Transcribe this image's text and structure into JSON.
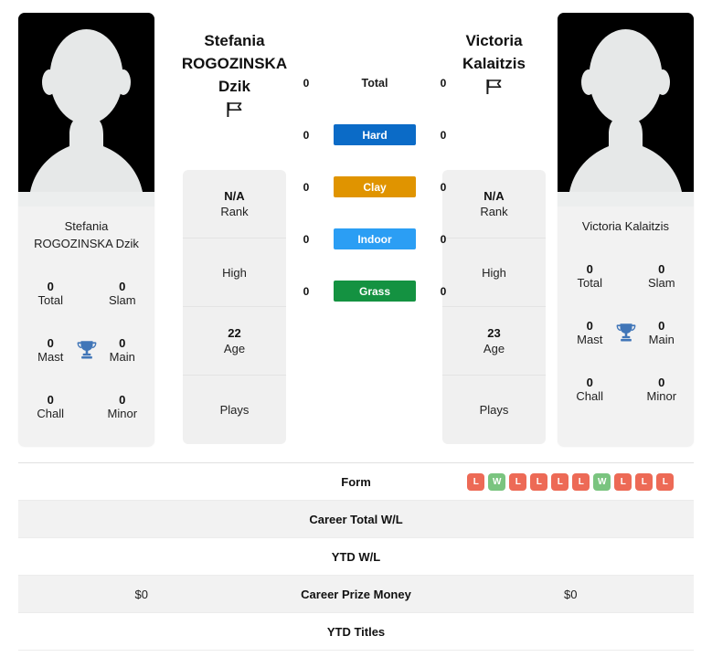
{
  "players": {
    "left": {
      "first_name": "Stefania",
      "last_name": "ROGOZINSKA Dzik",
      "display_name_line1": "Stefania",
      "display_name_line2": "ROGOZINSKA",
      "display_name_line3": "Dzik",
      "photo_caption": "Stefania ROGOZINSKA Dzik",
      "flag_icon": "flag-icon",
      "rank": "N/A",
      "rank_label": "Rank",
      "high_label": "High",
      "high_value": "",
      "age": "22",
      "age_label": "Age",
      "plays_label": "Plays",
      "plays_value": "",
      "titles": {
        "total": "0",
        "total_label": "Total",
        "slam": "0",
        "slam_label": "Slam",
        "mast": "0",
        "mast_label": "Mast",
        "main": "0",
        "main_label": "Main",
        "chall": "0",
        "chall_label": "Chall",
        "minor": "0",
        "minor_label": "Minor"
      },
      "career_total_wl": "",
      "ytd_wl": "",
      "career_prize_money": "$0",
      "ytd_titles": "",
      "form": []
    },
    "right": {
      "first_name": "Victoria",
      "last_name": "Kalaitzis",
      "display_name_line1": "Victoria",
      "display_name_line2": "Kalaitzis",
      "display_name_line3": "",
      "photo_caption": "Victoria Kalaitzis",
      "flag_icon": "flag-icon",
      "rank": "N/A",
      "rank_label": "Rank",
      "high_label": "High",
      "high_value": "",
      "age": "23",
      "age_label": "Age",
      "plays_label": "Plays",
      "plays_value": "",
      "titles": {
        "total": "0",
        "total_label": "Total",
        "slam": "0",
        "slam_label": "Slam",
        "mast": "0",
        "mast_label": "Mast",
        "main": "0",
        "main_label": "Main",
        "chall": "0",
        "chall_label": "Chall",
        "minor": "0",
        "minor_label": "Minor"
      },
      "career_total_wl": "",
      "ytd_wl": "",
      "career_prize_money": "$0",
      "ytd_titles": "",
      "form": [
        "L",
        "W",
        "L",
        "L",
        "L",
        "L",
        "W",
        "L",
        "L",
        "L"
      ]
    }
  },
  "surfaces": [
    {
      "label": "Total",
      "left": "0",
      "right": "0",
      "color": "transparent",
      "text_color": "#1c1c1c"
    },
    {
      "label": "Hard",
      "left": "0",
      "right": "0",
      "color": "#0b6bc7",
      "text_color": "#ffffff"
    },
    {
      "label": "Clay",
      "left": "0",
      "right": "0",
      "color": "#e09400",
      "text_color": "#ffffff"
    },
    {
      "label": "Indoor",
      "left": "0",
      "right": "0",
      "color": "#2b9ef4",
      "text_color": "#ffffff"
    },
    {
      "label": "Grass",
      "left": "0",
      "right": "0",
      "color": "#149241",
      "text_color": "#ffffff"
    }
  ],
  "table_rows": [
    {
      "label": "Form",
      "left": "",
      "right": ""
    },
    {
      "label": "Career Total W/L",
      "left": "",
      "right": ""
    },
    {
      "label": "YTD W/L",
      "left": "",
      "right": ""
    },
    {
      "label": "Career Prize Money",
      "left": "$0",
      "right": "$0"
    },
    {
      "label": "YTD Titles",
      "left": "",
      "right": ""
    }
  ],
  "colors": {
    "hard": "#0b6bc7",
    "clay": "#e09400",
    "indoor": "#2b9ef4",
    "grass": "#149241",
    "loss_badge": "#ed6a56",
    "win_badge": "#7ac47f",
    "card_bg": "#f0f0f0",
    "trophy": "#4176b8"
  }
}
